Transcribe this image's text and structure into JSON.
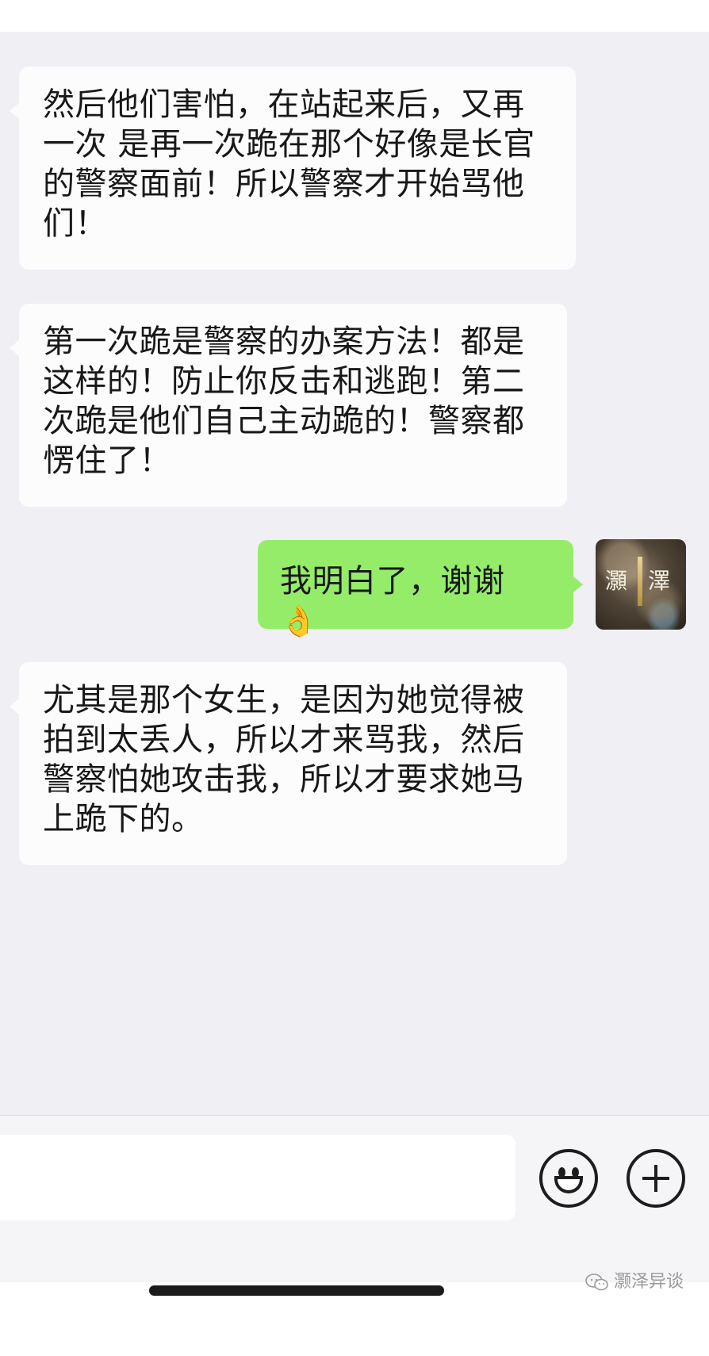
{
  "messages": [
    {
      "side": "in",
      "text": "然后他们害怕，在站起来后，又再一次 是再一次跪在那个好像是长官的警察面前！所以警察才开始骂他们！"
    },
    {
      "side": "in",
      "text": "第一次跪是警察的办案方法！都是这样的！防止你反击和逃跑！第二次跪是他们自己主动跪的！警察都愣住了！"
    },
    {
      "side": "out",
      "text": "我明白了，谢谢",
      "emoji": "👌"
    },
    {
      "side": "in",
      "text": "尤其是那个女生，是因为她觉得被拍到太丢人，所以才来骂我，然后警察怕她攻击我，所以才要求她马上跪下的。"
    }
  ],
  "avatar": {
    "glyph_left": "灝",
    "glyph_right": "澤"
  },
  "input_bar": {
    "emoji_icon": "smiley-face-icon",
    "plus_icon": "plus-circle-icon"
  },
  "watermark": {
    "text": "灏泽异谈",
    "icon": "wechat-icon"
  },
  "colors": {
    "chat_bg": "#f0eff4",
    "incoming_bubble": "#fcfcfd",
    "outgoing_bubble": "#95ec69"
  }
}
